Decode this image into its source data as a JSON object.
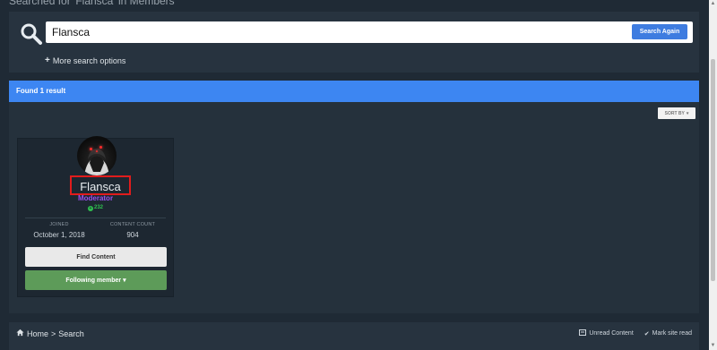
{
  "page": {
    "header_text": "Searched for 'Flansca' in Members"
  },
  "search": {
    "value": "Flansca",
    "submit_label": "Search Again",
    "more_options_label": "More search options",
    "icon": "search-icon"
  },
  "results": {
    "found_label": "Found 1 result",
    "sort_label": "SORT BY"
  },
  "member": {
    "name": "Flansca",
    "group": "Moderator",
    "reputation": "232",
    "joined_label": "JOINED",
    "joined_value": "October 1, 2018",
    "content_count_label": "CONTENT COUNT",
    "content_count_value": "904",
    "find_content_label": "Find Content",
    "following_label": "Following member"
  },
  "footer": {
    "breadcrumb_home": "Home",
    "breadcrumb_separator": ">",
    "breadcrumb_current": "Search",
    "unread_label": "Unread Content",
    "mark_read_label": "Mark site read"
  },
  "colors": {
    "accent_blue": "#3d86f2",
    "follow_green": "#5d9b59",
    "moderator_purple": "#9b4ff0",
    "highlight_red": "#e11c1c"
  }
}
